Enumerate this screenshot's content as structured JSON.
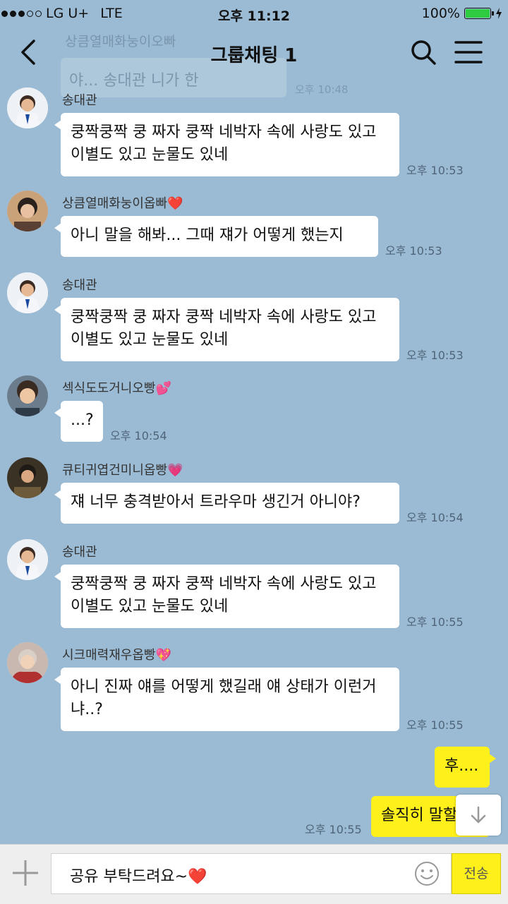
{
  "status_bar": {
    "carrier": "LG U+",
    "network": "LTE",
    "time": "오후 11:12",
    "battery": "100%",
    "battery_level": 1.0
  },
  "header": {
    "title": "그룹채팅 1",
    "ghost_sender": "상큼열매화눙이오빠",
    "ghost_message": "야... 송대관 니가 한",
    "ghost_time": "오후 10:48"
  },
  "messages": [
    {
      "sender": "송대관",
      "text": "쿵짝쿵짝 쿵 짜자 쿵짝 네박자 속에 사랑도 있고 이별도 있고 눈물도 있네",
      "time": "오후 10:53"
    },
    {
      "sender": "상큼열매화눙이옵빠❤️",
      "text": "아니 말을 해봐... 그때 쟤가 어떻게 했는지",
      "time": "오후 10:53"
    },
    {
      "sender": "송대관",
      "text": "쿵짝쿵짝 쿵 짜자 쿵짝 네박자 속에 사랑도 있고 이별도 있고 눈물도 있네",
      "time": "오후 10:53"
    },
    {
      "sender": "섹식도도거니오빵💕",
      "text": "...?",
      "time": "오후 10:54"
    },
    {
      "sender": "큐티귀엽건미니옵빵💗",
      "text": "쟤 너무 충격받아서 트라우마 생긴거 아니야?",
      "time": "오후 10:54"
    },
    {
      "sender": "송대관",
      "text": "쿵짝쿵짝 쿵 짜자 쿵짝 네박자 속에 사랑도 있고 이별도 있고 눈물도 있네",
      "time": "오후 10:55"
    },
    {
      "sender": "시크매력재우옵빵💖",
      "text": "아니 진짜 얘를 어떻게 했길래 얘 상태가 이런거냐..?",
      "time": "오후 10:55"
    }
  ],
  "my_messages": [
    {
      "text": "후...."
    },
    {
      "text": "솔직히 말할",
      "time": "오후 10:55"
    }
  ],
  "input": {
    "value": "공유 부탁드려요~❤️",
    "send_label": "전송"
  },
  "colors": {
    "background": "#9bbbd4",
    "my_bubble": "#fef01b",
    "other_bubble": "#ffffff"
  }
}
